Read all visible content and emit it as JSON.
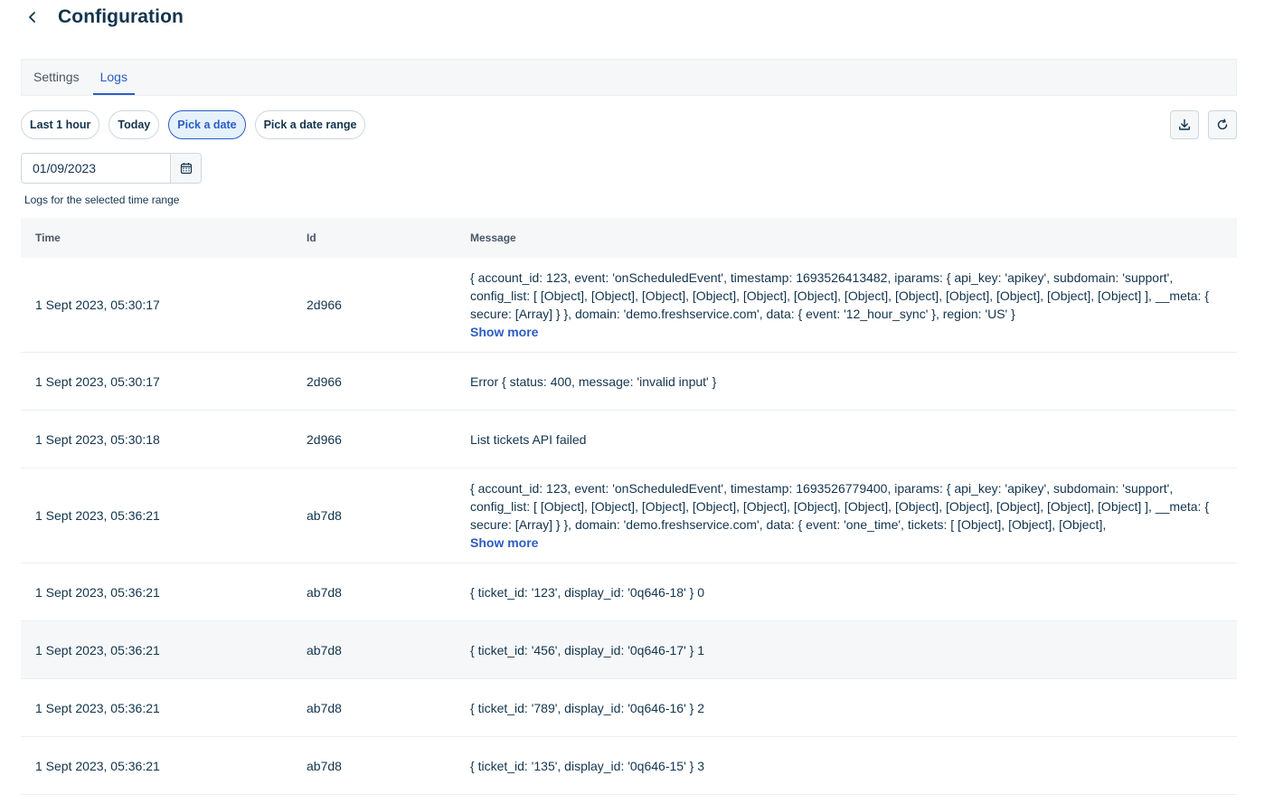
{
  "header": {
    "title": "Configuration"
  },
  "tabs": [
    {
      "label": "Settings",
      "active": false
    },
    {
      "label": "Logs",
      "active": true
    }
  ],
  "filters": [
    {
      "label": "Last 1 hour",
      "selected": false
    },
    {
      "label": "Today",
      "selected": false
    },
    {
      "label": "Pick a date",
      "selected": true
    },
    {
      "label": "Pick a date range",
      "selected": false
    }
  ],
  "actions": {
    "download_icon": "download-icon",
    "refresh_icon": "refresh-icon"
  },
  "date_picker": {
    "value": "01/09/2023",
    "icon": "calendar-icon"
  },
  "caption": "Logs for the selected time range",
  "table": {
    "columns": [
      "Time",
      "Id",
      "Message"
    ],
    "show_more_label": "Show more",
    "rows": [
      {
        "time": "1 Sept 2023, 05:30:17",
        "id": "2d966",
        "message": "{ account_id: 123, event: 'onScheduledEvent', timestamp: 1693526413482, iparams: { api_key: 'apikey', subdomain: 'support', config_list: [ [Object], [Object], [Object], [Object], [Object], [Object], [Object], [Object], [Object], [Object], [Object], [Object] ], __meta: { secure: [Array] } }, domain: 'demo.freshservice.com', data: { event: '12_hour_sync' }, region: 'US' }"
      },
      {
        "time": "1 Sept 2023, 05:30:17",
        "id": "2d966",
        "message": "Error { status: 400, message: 'invalid input' }"
      },
      {
        "time": "1 Sept 2023, 05:30:18",
        "id": "2d966",
        "message": "List tickets API failed"
      },
      {
        "time": "1 Sept 2023, 05:36:21",
        "id": "ab7d8",
        "message": "{ account_id: 123, event: 'onScheduledEvent', timestamp: 1693526779400, iparams: { api_key: 'apikey', subdomain: 'support', config_list: [ [Object], [Object], [Object], [Object], [Object], [Object], [Object], [Object], [Object], [Object], [Object], [Object] ], __meta: { secure: [Array] } }, domain: 'demo.freshservice.com', data: { event: 'one_time', tickets: [ [Object], [Object], [Object],"
      },
      {
        "time": "1 Sept 2023, 05:36:21",
        "id": "ab7d8",
        "message": "{ ticket_id: '123', display_id: '0q646-18' } 0"
      },
      {
        "time": "1 Sept 2023, 05:36:21",
        "id": "ab7d8",
        "message": "{ ticket_id: '456', display_id: '0q646-17' } 1"
      },
      {
        "time": "1 Sept 2023, 05:36:21",
        "id": "ab7d8",
        "message": "{ ticket_id: '789', display_id: '0q646-16' } 2"
      },
      {
        "time": "1 Sept 2023, 05:36:21",
        "id": "ab7d8",
        "message": "{ ticket_id: '135', display_id: '0q646-15' } 3"
      }
    ]
  },
  "colors": {
    "accent": "#2c5cc5",
    "text": "#12344d",
    "header_bg": "#f5f7f9",
    "pill_selected_bg": "#e5f2fd"
  }
}
